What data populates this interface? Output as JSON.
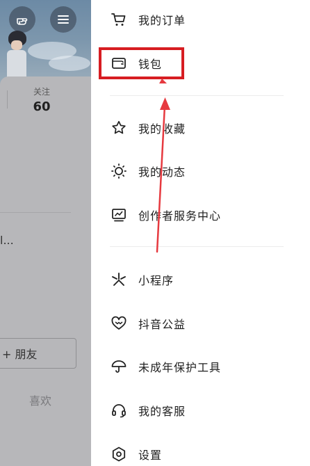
{
  "background": {
    "stats": {
      "follow_label": "关注",
      "follow_value": "60"
    },
    "ellipsis": "l...",
    "friend_button": "+ 朋友",
    "likes_tab": "喜欢",
    "left_button_icon": "pointing-hand-icon",
    "menu_button_icon": "hamburger-icon"
  },
  "drawer": {
    "items": [
      {
        "label": "我的订单",
        "icon": "cart-icon"
      },
      {
        "label": "钱包",
        "icon": "wallet-icon"
      },
      {
        "label": "我的收藏",
        "icon": "star-icon"
      },
      {
        "label": "我的动态",
        "icon": "activity-icon"
      },
      {
        "label": "创作者服务中心",
        "icon": "chart-icon"
      },
      {
        "label": "小程序",
        "icon": "mini-program-icon"
      },
      {
        "label": "抖音公益",
        "icon": "charity-heart-icon"
      },
      {
        "label": "未成年保护工具",
        "icon": "umbrella-icon"
      },
      {
        "label": "我的客服",
        "icon": "headset-icon"
      },
      {
        "label": "设置",
        "icon": "settings-icon"
      }
    ]
  },
  "annotation": {
    "highlight_color": "#d71d22",
    "arrow_color": "#e6393f"
  }
}
